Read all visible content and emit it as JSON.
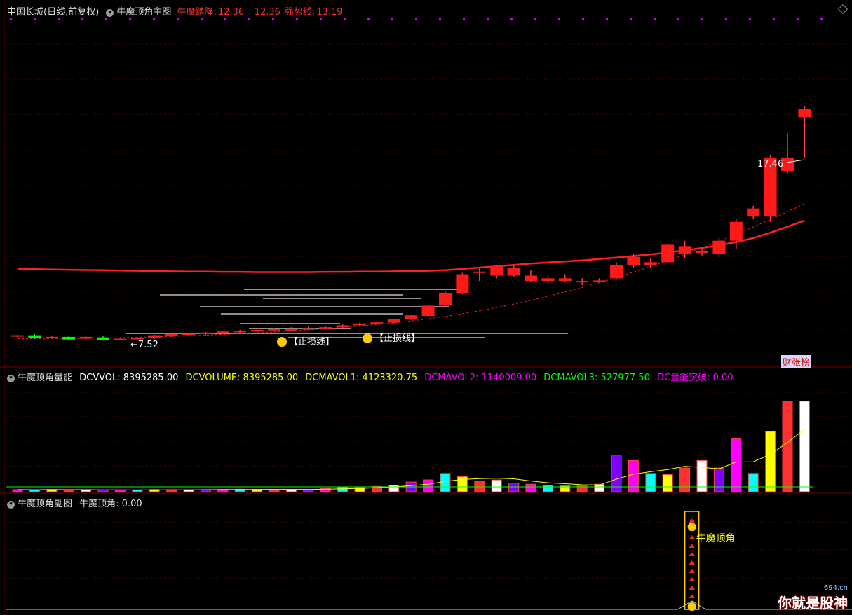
{
  "main_header": {
    "stock": "中国长城(日线,前复权)",
    "indicator": "牛魔顶角主图",
    "label1": "牛魔踏降:",
    "value1": "12.36",
    "value1b": ": 12.36",
    "label2": "强势线:",
    "value2": "13.19"
  },
  "vol_header": {
    "indicator": "牛魔顶角量能",
    "dcvvol": "DCVVOL: 8395285.00",
    "dcvolume": "DCVOLUME: 8395285.00",
    "dcmavol1": "DCMAVOL1: 4123320.75",
    "dcmavol2": "DCMAVOL2: 1140009.00",
    "dcmavol3": "DCMAVOL3: 527977.50",
    "breakout": "DC量能突破: 0.00"
  },
  "sub_header": {
    "indicator": "牛魔顶角副图",
    "value": "牛魔顶角: 0.00"
  },
  "badge": "财张榜",
  "watermark": {
    "text": "你就是股神",
    "site": "694.cn"
  },
  "chart_data": [
    {
      "type": "candlestick",
      "title": "中国长城(日线,前复权)",
      "annotations": [
        "17.46",
        "7.52",
        "【止损线】",
        "【止损线】"
      ],
      "high_label": "17.46",
      "low_label": "7.52",
      "ohlc": [
        [
          7.55,
          7.6,
          7.5,
          7.58
        ],
        [
          7.58,
          7.62,
          7.45,
          7.48
        ],
        [
          7.5,
          7.55,
          7.45,
          7.52
        ],
        [
          7.52,
          7.56,
          7.4,
          7.42
        ],
        [
          7.45,
          7.55,
          7.42,
          7.52
        ],
        [
          7.5,
          7.54,
          7.38,
          7.4
        ],
        [
          7.45,
          7.5,
          7.4,
          7.45
        ],
        [
          7.46,
          7.52,
          7.4,
          7.48
        ],
        [
          7.48,
          7.6,
          7.45,
          7.58
        ],
        [
          7.55,
          7.65,
          7.52,
          7.62
        ],
        [
          7.6,
          7.68,
          7.56,
          7.64
        ],
        [
          7.62,
          7.7,
          7.58,
          7.68
        ],
        [
          7.66,
          7.75,
          7.62,
          7.72
        ],
        [
          7.7,
          7.78,
          7.66,
          7.74
        ],
        [
          7.72,
          7.8,
          7.68,
          7.78
        ],
        [
          7.76,
          7.85,
          7.72,
          7.82
        ],
        [
          7.8,
          7.88,
          7.76,
          7.8
        ],
        [
          7.82,
          7.9,
          7.78,
          7.84
        ],
        [
          7.85,
          7.92,
          7.8,
          7.88
        ],
        [
          7.88,
          7.98,
          7.85,
          7.95
        ],
        [
          7.95,
          8.05,
          7.92,
          8.02
        ],
        [
          8.0,
          8.1,
          7.96,
          8.06
        ],
        [
          8.05,
          8.2,
          8.02,
          8.18
        ],
        [
          8.18,
          8.35,
          8.15,
          8.32
        ],
        [
          8.3,
          8.7,
          8.28,
          8.68
        ],
        [
          8.68,
          9.2,
          8.65,
          9.15
        ],
        [
          9.15,
          9.9,
          9.1,
          9.85
        ],
        [
          9.9,
          10.1,
          9.6,
          9.95
        ],
        [
          9.8,
          10.2,
          9.7,
          10.15
        ],
        [
          10.1,
          10.2,
          9.75,
          9.8
        ],
        [
          9.8,
          10.0,
          9.55,
          9.6
        ],
        [
          9.6,
          9.8,
          9.5,
          9.7
        ],
        [
          9.7,
          9.85,
          9.55,
          9.6
        ],
        [
          9.6,
          9.7,
          9.45,
          9.55
        ],
        [
          9.6,
          9.7,
          9.55,
          9.62
        ],
        [
          9.7,
          10.3,
          9.65,
          10.2
        ],
        [
          10.2,
          10.6,
          10.1,
          10.5
        ],
        [
          10.3,
          10.45,
          10.1,
          10.2
        ],
        [
          10.3,
          11.0,
          10.25,
          10.95
        ],
        [
          10.6,
          11.1,
          10.45,
          10.9
        ],
        [
          10.7,
          10.8,
          10.55,
          10.65
        ],
        [
          10.6,
          11.2,
          10.5,
          11.1
        ],
        [
          11.1,
          11.9,
          10.8,
          11.8
        ],
        [
          12.3,
          12.4,
          11.9,
          12.0
        ],
        [
          12.0,
          14.3,
          11.8,
          14.2
        ],
        [
          14.2,
          15.1,
          13.6,
          13.7
        ],
        [
          15.7,
          16.1,
          14.2,
          16.0
        ]
      ],
      "ma": [
        10.05,
        10.04,
        10.03,
        10.02,
        10.01,
        10.0,
        9.99,
        9.98,
        9.97,
        9.96,
        9.95,
        9.95,
        9.94,
        9.94,
        9.93,
        9.93,
        9.93,
        9.93,
        9.94,
        9.94,
        9.95,
        9.95,
        9.96,
        9.97,
        9.98,
        10.0,
        10.05,
        10.1,
        10.15,
        10.2,
        10.25,
        10.29,
        10.33,
        10.37,
        10.42,
        10.47,
        10.53,
        10.59,
        10.66,
        10.74,
        10.83,
        10.93,
        11.05,
        11.2,
        11.4,
        11.62,
        11.85
      ],
      "dashed_ma": [
        7.45,
        7.45,
        7.46,
        7.46,
        7.47,
        7.48,
        7.49,
        7.5,
        7.52,
        7.54,
        7.56,
        7.58,
        7.61,
        7.64,
        7.67,
        7.7,
        7.74,
        7.78,
        7.82,
        7.87,
        7.92,
        7.98,
        8.04,
        8.11,
        8.19,
        8.28,
        8.38,
        8.49,
        8.61,
        8.74,
        8.88,
        9.03,
        9.19,
        9.36,
        9.54,
        9.73,
        9.93,
        10.14,
        10.36,
        10.59,
        10.83,
        11.08,
        11.34,
        11.61,
        11.89,
        12.18,
        12.48
      ]
    },
    {
      "type": "bar",
      "title": "牛魔顶角量能",
      "series": [
        {
          "name": "DCVOLUME",
          "values": [
            200000,
            180000,
            220000,
            170000,
            190000,
            160000,
            150000,
            170000,
            210000,
            190000,
            180000,
            200000,
            220000,
            240000,
            230000,
            210000,
            220000,
            200000,
            300000,
            450000,
            420000,
            500000,
            600000,
            900000,
            1100000,
            1700000,
            1400000,
            1000000,
            1100000,
            800000,
            700000,
            600000,
            550000,
            600000,
            700000,
            3400000,
            2900000,
            1700000,
            1600000,
            2200000,
            2900000,
            2200000,
            4900000,
            1700000,
            5600000,
            8395285,
            8395285
          ]
        }
      ],
      "ylim": [
        0,
        10000000
      ]
    },
    {
      "type": "bar",
      "title": "牛魔顶角副图",
      "signal_label": "牛魔顶角",
      "series": [
        {
          "name": "牛魔顶角",
          "values": [
            0,
            0,
            0,
            0,
            0,
            0,
            0,
            0,
            0,
            0,
            0,
            0,
            0,
            0,
            0,
            0,
            0,
            0,
            0,
            0,
            0,
            0,
            0,
            0,
            0,
            0,
            0,
            0,
            0,
            0,
            0,
            0,
            0,
            0,
            0,
            0,
            0,
            0,
            0,
            1,
            0,
            0,
            0,
            0,
            0,
            0,
            0
          ]
        }
      ]
    }
  ]
}
